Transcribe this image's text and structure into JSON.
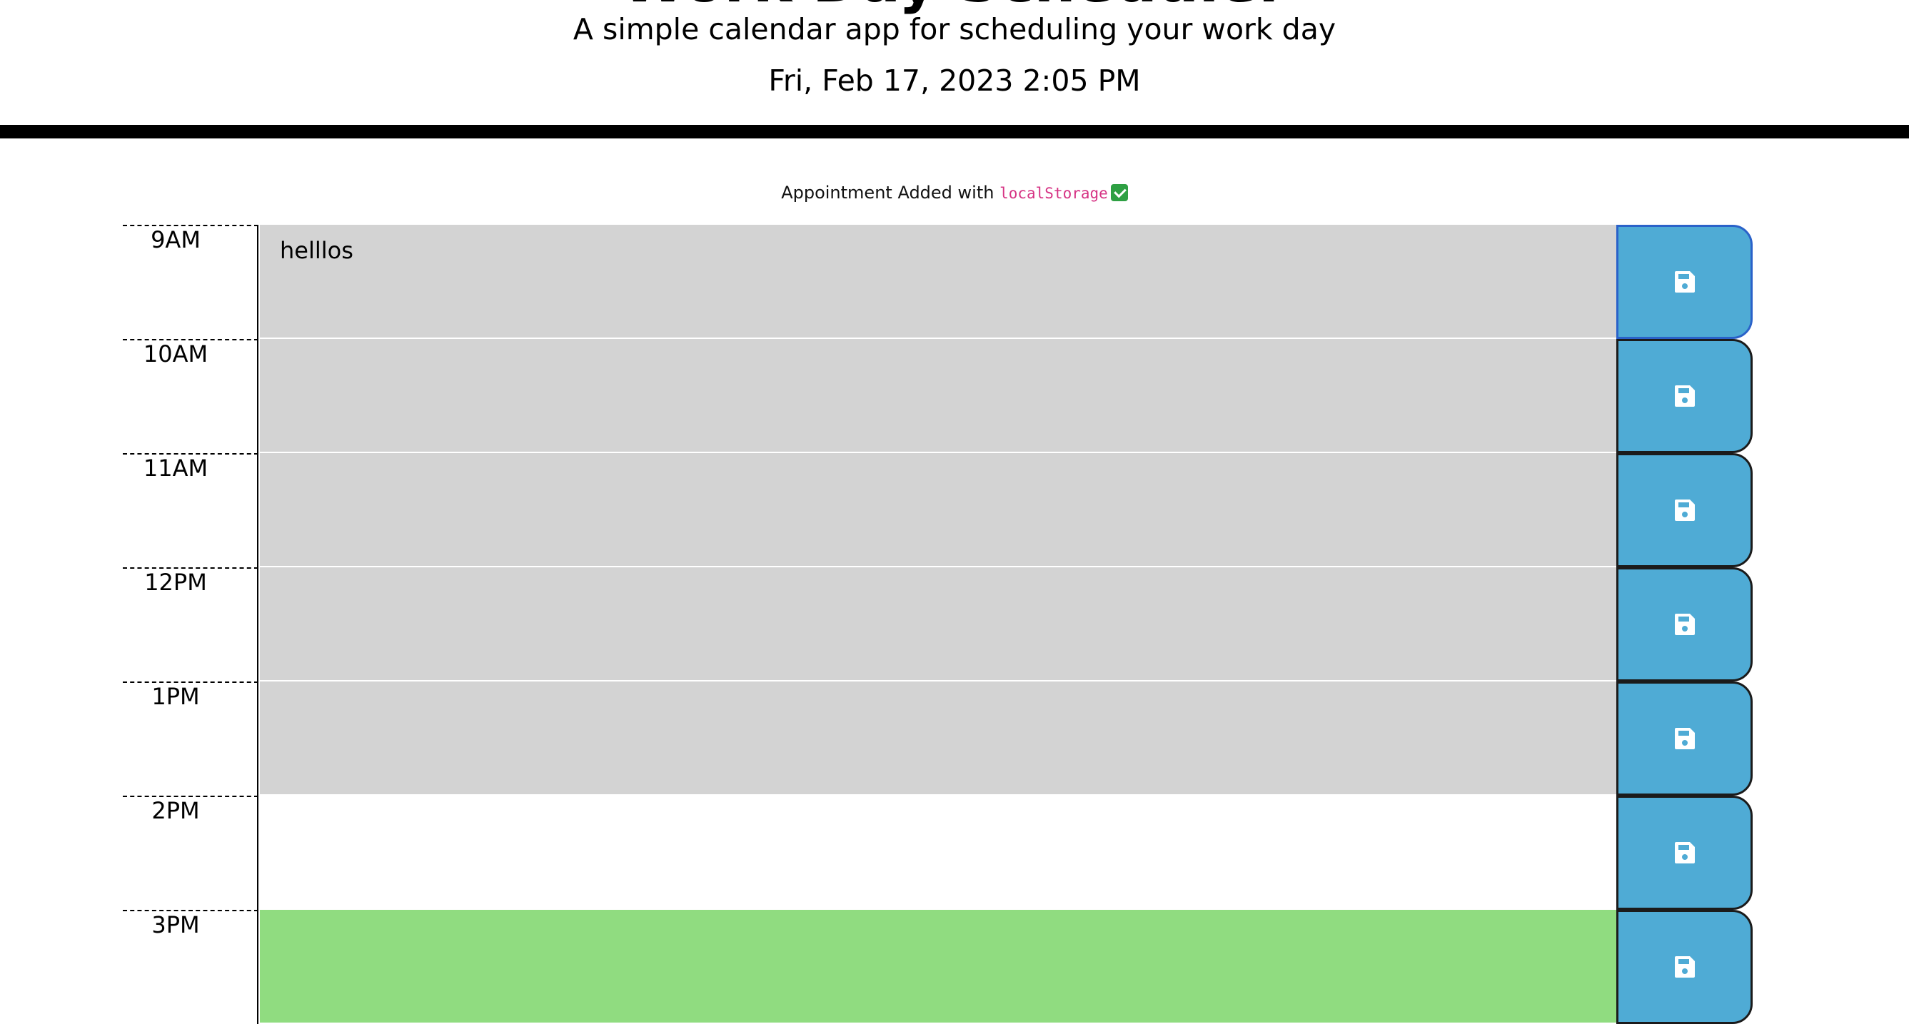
{
  "header": {
    "title": "Work Day Scheduler",
    "lead": "A simple calendar app for scheduling your work day",
    "current_day": "Fri, Feb 17, 2023 2:05 PM"
  },
  "notice": {
    "prefix": "Appointment Added with ",
    "code": "localStorage",
    "icon": "check-mark-icon",
    "icon_color": "#2ea043"
  },
  "colors": {
    "past": "#d3d3d3",
    "present": "#ffffff",
    "future": "#90dc80",
    "save_button": "#4fabd5"
  },
  "blocks": [
    {
      "hour": "9AM",
      "text": "helllos",
      "state": "past"
    },
    {
      "hour": "10AM",
      "text": "",
      "state": "past"
    },
    {
      "hour": "11AM",
      "text": "",
      "state": "past"
    },
    {
      "hour": "12PM",
      "text": "",
      "state": "past"
    },
    {
      "hour": "1PM",
      "text": "",
      "state": "past"
    },
    {
      "hour": "2PM",
      "text": "",
      "state": "present"
    },
    {
      "hour": "3PM",
      "text": "",
      "state": "future"
    }
  ],
  "save_icon": "save-icon"
}
